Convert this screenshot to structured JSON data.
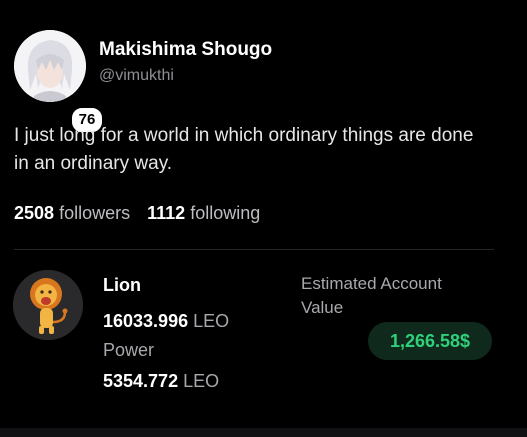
{
  "profile": {
    "name": "Makishima Shougo",
    "handle": "@vimukthi",
    "reputation": "76",
    "bio": "I just long for a world in which ordinary things are done in an ordinary way."
  },
  "stats": {
    "followers_count": "2508",
    "followers_label": "followers",
    "following_count": "1112",
    "following_label": "following"
  },
  "wallet": {
    "rank_name": "Lion",
    "rank_icon": "lion-icon",
    "leo_amount": "16033.996",
    "leo_unit": "LEO",
    "power_label": "Power",
    "power_amount": "5354.772",
    "power_unit": "LEO",
    "estimated_label": "Estimated Account Value",
    "estimated_value": "1,266.58$"
  },
  "colors": {
    "background": "#000000",
    "value_text": "#2fd07a",
    "value_pill_bg": "#0f2a1c",
    "muted_text": "#8e8e94"
  }
}
